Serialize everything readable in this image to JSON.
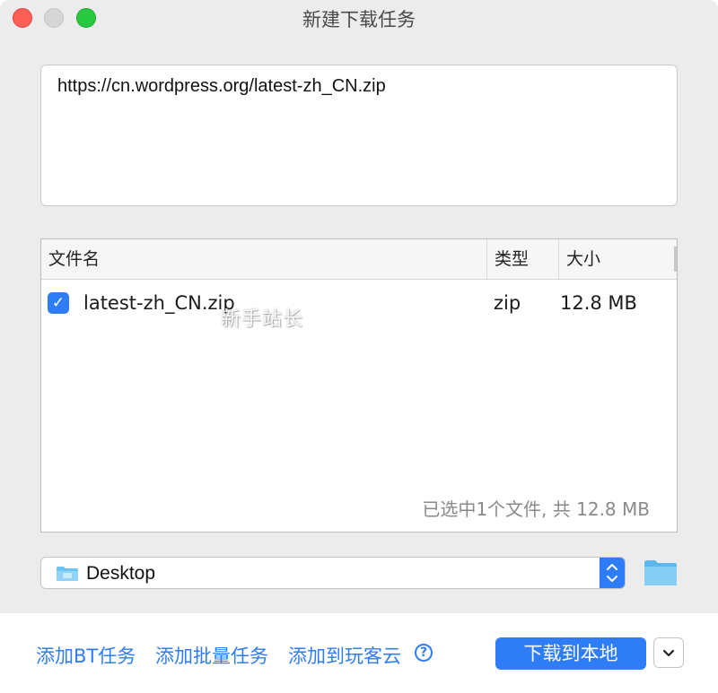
{
  "window": {
    "title": "新建下载任务"
  },
  "url_input": {
    "value": "https://cn.wordpress.org/latest-zh_CN.zip"
  },
  "file_table": {
    "columns": [
      "文件名",
      "类型",
      "大小"
    ],
    "rows": [
      {
        "checked": true,
        "name": "latest-zh_CN.zip",
        "type": "zip",
        "size": "12.8 MB"
      }
    ],
    "summary": "已选中1个文件, 共 12.8 MB"
  },
  "watermark": "新手站长",
  "save_location": {
    "selected": "Desktop",
    "icon": "folder-icon"
  },
  "footer": {
    "add_bt_label": "添加BT任务",
    "add_batch_label": "添加批量任务",
    "add_cloud_label": "添加到玩客云",
    "download_label": "下载到本地"
  },
  "colors": {
    "accent": "#2f7df6",
    "close": "#fe5f57",
    "maximize": "#28c840",
    "folder": "#6cc3f3"
  }
}
